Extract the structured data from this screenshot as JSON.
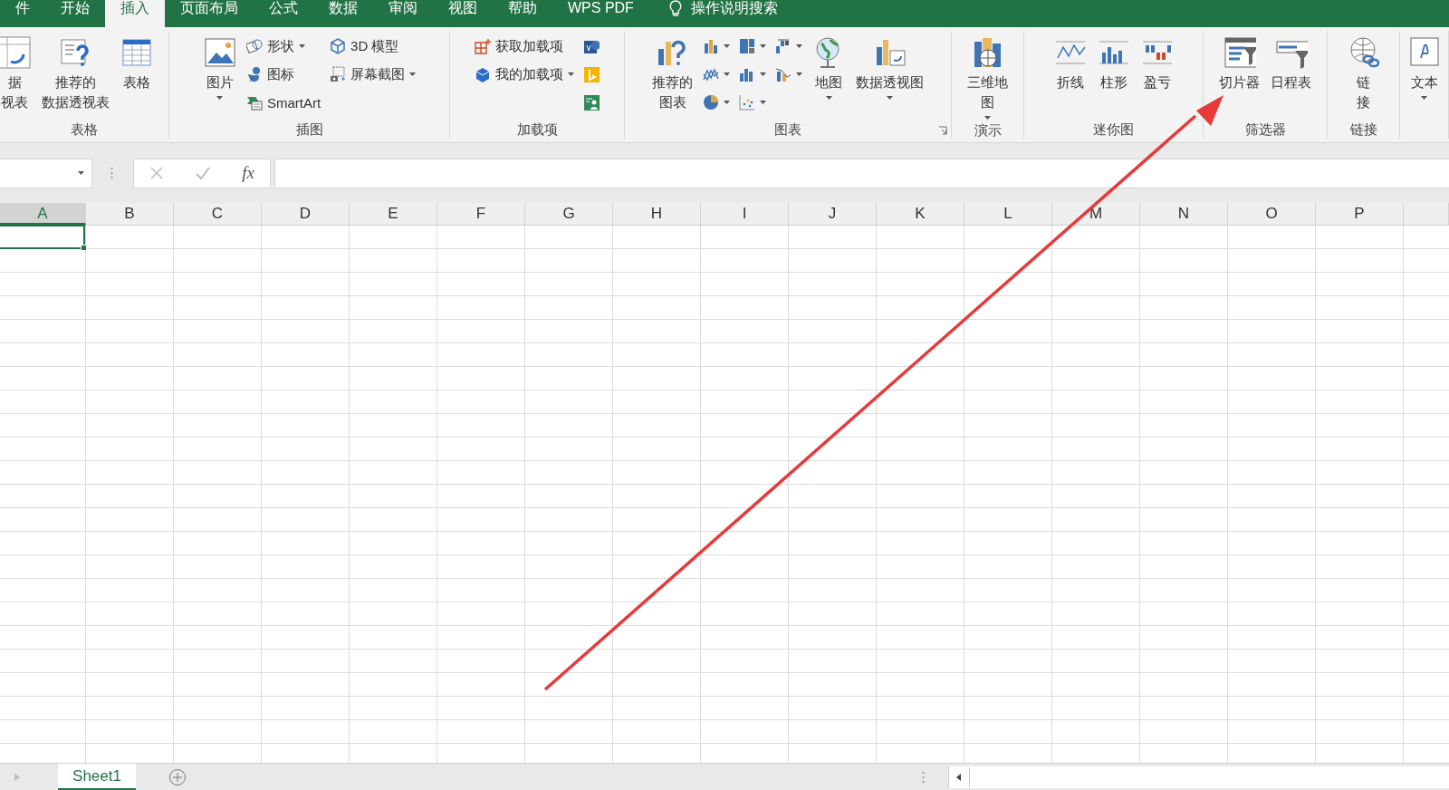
{
  "ribbon_tabs": [
    {
      "label": "件",
      "selected": false
    },
    {
      "label": "开始",
      "selected": false
    },
    {
      "label": "插入",
      "selected": true
    },
    {
      "label": "页面布局",
      "selected": false
    },
    {
      "label": "公式",
      "selected": false
    },
    {
      "label": "数据",
      "selected": false
    },
    {
      "label": "审阅",
      "selected": false
    },
    {
      "label": "视图",
      "selected": false
    },
    {
      "label": "帮助",
      "selected": false
    },
    {
      "label": "WPS PDF",
      "selected": false
    }
  ],
  "tell_me": {
    "label": "操作说明搜索"
  },
  "ribbon_groups": [
    {
      "label": "表格",
      "items": [
        {
          "kind": "large",
          "lines": [
            "据",
            "视表"
          ],
          "dropdown": false
        },
        {
          "kind": "large",
          "lines": [
            "推荐的",
            "数据透视表"
          ],
          "dropdown": false
        },
        {
          "kind": "large",
          "label": "表格",
          "dropdown": false
        }
      ]
    },
    {
      "label": "插图",
      "items": [
        {
          "kind": "large",
          "label": "图片",
          "dropdown": true
        },
        {
          "kind": "stack",
          "items": [
            {
              "kind": "small",
              "label": "形状",
              "dropdown": true
            },
            {
              "kind": "small",
              "label": "图标",
              "dropdown": false
            },
            {
              "kind": "small",
              "label": "SmartArt",
              "dropdown": false
            }
          ]
        },
        {
          "kind": "stack",
          "items": [
            {
              "kind": "small",
              "label": "3D 模型",
              "dropdown": false
            },
            {
              "kind": "small",
              "label": "屏幕截图",
              "dropdown": true
            }
          ]
        }
      ]
    },
    {
      "label": "加载项",
      "items": [
        {
          "kind": "stack",
          "items": [
            {
              "kind": "small",
              "label": "获取加载项",
              "dropdown": false
            },
            {
              "kind": "small",
              "label": "我的加载项",
              "dropdown": true
            }
          ]
        },
        {
          "kind": "stack",
          "items": [
            {
              "kind": "icon",
              "dropdown": false
            },
            {
              "kind": "icon",
              "dropdown": false
            },
            {
              "kind": "icon",
              "dropdown": false
            }
          ]
        }
      ]
    },
    {
      "label": "图表",
      "launcher": true,
      "items": [
        {
          "kind": "large",
          "lines": [
            "推荐的",
            "图表"
          ],
          "dropdown": false
        },
        {
          "kind": "stack",
          "items": [
            {
              "kind": "icon",
              "dropdown": true
            },
            {
              "kind": "icon",
              "dropdown": true
            },
            {
              "kind": "icon",
              "dropdown": true
            }
          ]
        },
        {
          "kind": "stack",
          "items": [
            {
              "kind": "icon",
              "dropdown": true
            },
            {
              "kind": "icon",
              "dropdown": true
            },
            {
              "kind": "icon",
              "dropdown": true
            }
          ]
        },
        {
          "kind": "stack",
          "items": [
            {
              "kind": "icon",
              "dropdown": true
            },
            {
              "kind": "icon",
              "dropdown": true
            }
          ]
        },
        {
          "kind": "large",
          "label": "地图",
          "dropdown": true
        },
        {
          "kind": "large",
          "label": "数据透视图",
          "dropdown": true
        }
      ]
    },
    {
      "label": "演示",
      "items": [
        {
          "kind": "large",
          "lines": [
            "三维地",
            "图"
          ],
          "dropdown": true
        }
      ]
    },
    {
      "label": "迷你图",
      "items": [
        {
          "kind": "large",
          "label": "折线",
          "dropdown": false
        },
        {
          "kind": "large",
          "label": "柱形",
          "dropdown": false
        },
        {
          "kind": "large",
          "label": "盈亏",
          "dropdown": false
        }
      ]
    },
    {
      "label": "筛选器",
      "items": [
        {
          "kind": "large",
          "label": "切片器",
          "dropdown": false
        },
        {
          "kind": "large",
          "label": "日程表",
          "dropdown": false
        }
      ]
    },
    {
      "label": "链接",
      "items": [
        {
          "kind": "large",
          "lines": [
            "链",
            "接"
          ],
          "dropdown": false
        }
      ]
    },
    {
      "items": [
        {
          "kind": "large",
          "label": "文本",
          "dropdown": true
        }
      ]
    }
  ],
  "formula_bar": {
    "function_label": "fx"
  },
  "columns": [
    {
      "label": "A",
      "selected": true
    },
    {
      "label": "B",
      "selected": false
    },
    {
      "label": "C",
      "selected": false
    },
    {
      "label": "D",
      "selected": false
    },
    {
      "label": "E",
      "selected": false
    },
    {
      "label": "F",
      "selected": false
    },
    {
      "label": "G",
      "selected": false
    },
    {
      "label": "H",
      "selected": false
    },
    {
      "label": "I",
      "selected": false
    },
    {
      "label": "J",
      "selected": false
    },
    {
      "label": "K",
      "selected": false
    },
    {
      "label": "L",
      "selected": false
    },
    {
      "label": "M",
      "selected": false
    },
    {
      "label": "N",
      "selected": false
    },
    {
      "label": "O",
      "selected": false
    },
    {
      "label": "P",
      "selected": false
    }
  ],
  "sheets": [
    {
      "label": "Sheet1",
      "selected": true
    }
  ]
}
